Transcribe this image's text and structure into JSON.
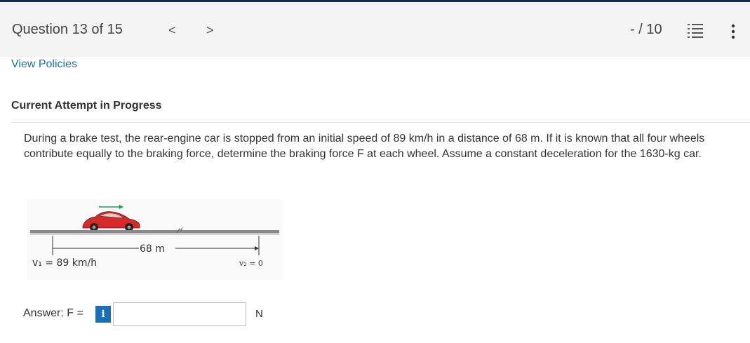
{
  "header": {
    "question_title": "Question 13 of 15",
    "prev_label": "<",
    "next_label": ">",
    "score": "- / 10"
  },
  "links": {
    "view_policies": "View Policies"
  },
  "attempt_status": "Current Attempt in Progress",
  "problem_text": "During a brake test, the rear-engine car is stopped from an initial speed of 89 km/h in a distance of 68 m. If it is known that all four wheels contribute equally to the braking force, determine the braking force F at each wheel. Assume a constant deceleration for the 1630-kg car.",
  "figure": {
    "distance_label": "68 m",
    "v1_label": "v₁ = 89  km/h",
    "v2_label": "v₂ = 0"
  },
  "answer": {
    "label": "Answer: F = ",
    "info_label": "i",
    "value": "",
    "unit": "N"
  },
  "colors": {
    "header_bg": "#f3f3f3",
    "top_bar": "#1b2a44",
    "link": "#1a6fb5",
    "info_button": "#1a6fb5",
    "car": "#d32a2a",
    "arrow": "#1e9e5a"
  },
  "icons": [
    "chevron-left-icon",
    "chevron-right-icon",
    "question-list-icon",
    "more-vertical-icon",
    "info-icon"
  ]
}
